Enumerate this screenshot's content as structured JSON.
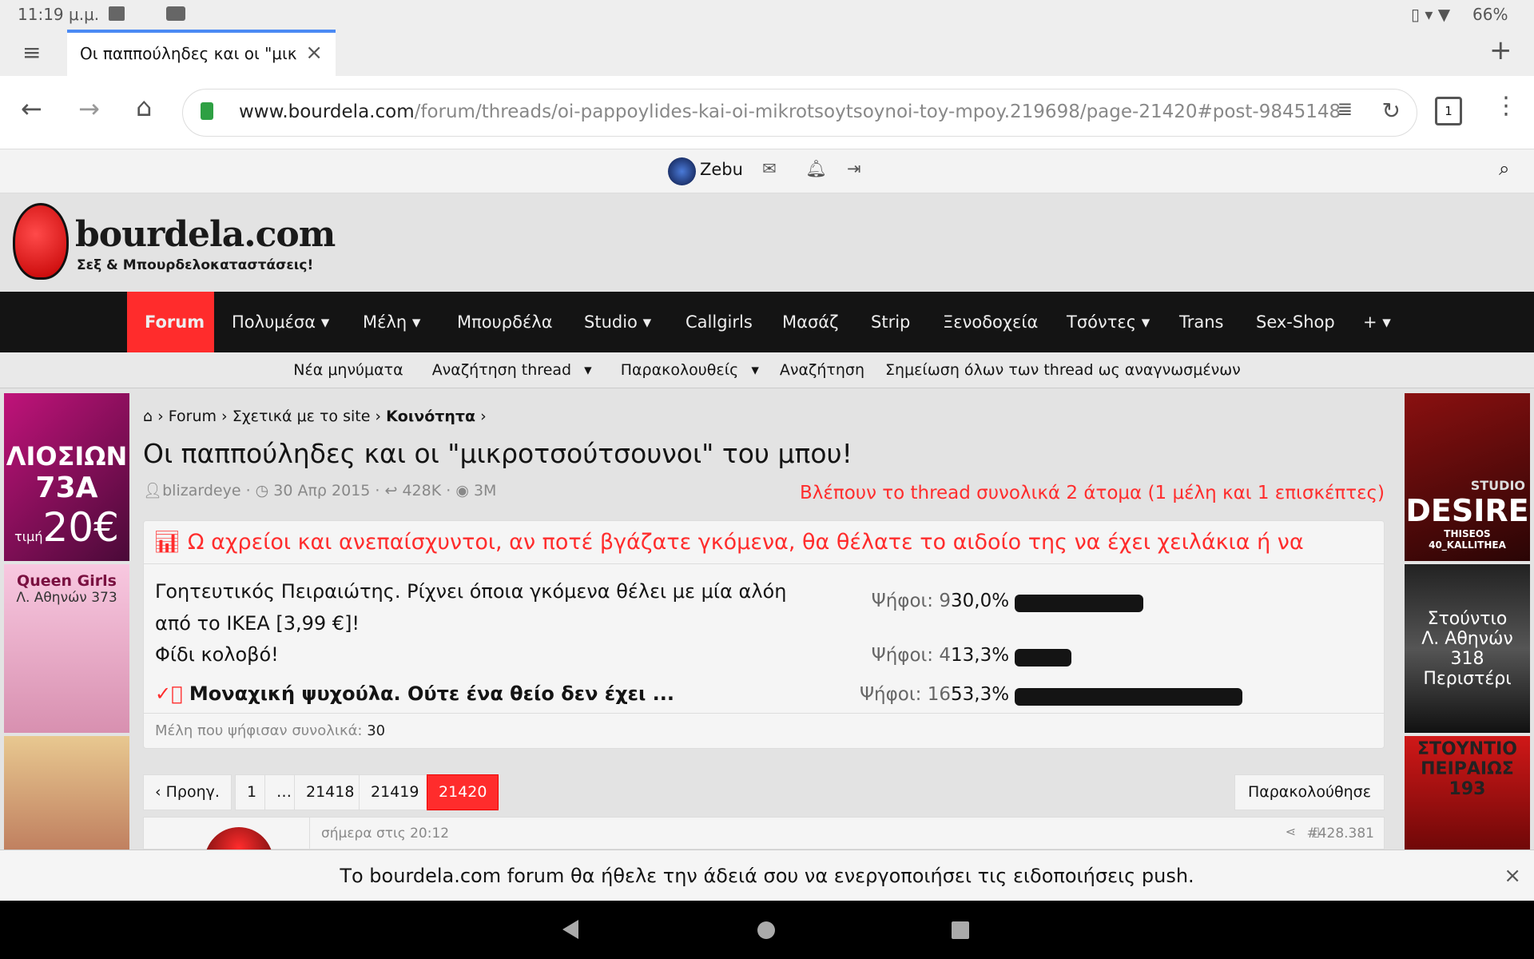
{
  "status": {
    "time": "11:19 μ.μ.",
    "battery": "66%"
  },
  "browser": {
    "tab_title": "Οι παππούληδες και οι \"μικ",
    "url_host": "www.bourdela.com",
    "url_path": "/forum/threads/oi-pappoylides-kai-oi-mikrotsoytsoynoi-toy-mpoy.219698/page-21420#post-9845148",
    "tab_count": "1"
  },
  "userbar": {
    "username": "Zebu"
  },
  "logo": {
    "name": "bourdela.com",
    "tagline": "Σεξ & Μπουρδελοκαταστάσεις!"
  },
  "nav": [
    "Forum",
    "Πολυμέσα",
    "Μέλη",
    "Μπουρδέλα",
    "Studio",
    "Callgirls",
    "Μασάζ",
    "Strip",
    "Ξενοδοχεία",
    "Τσόντες",
    "Trans",
    "Sex-Shop",
    "+"
  ],
  "subnav": [
    "Νέα μηνύματα",
    "Αναζήτηση thread",
    "Παρακολουθείς",
    "Αναζήτηση",
    "Σημείωση όλων των thread ως αναγνωσμένων"
  ],
  "breadcrumb": [
    "Forum",
    "Σχετικά με το site",
    "Κοινότητα"
  ],
  "thread": {
    "title": "Οι παππούληδες και οι \"μικροτσούτσουνοι\" του μπου!",
    "author": "blizardeye",
    "date": "30 Απρ 2015",
    "replies": "428K",
    "views": "3M",
    "viewers": "Βλέπουν το thread συνολικά 2 άτομα (1 μέλη και 1 επισκέπτες)"
  },
  "poll": {
    "question": "Ω αχρείοι και ανεπαίσχυντοι, αν ποτέ βγάζατε γκόμενα, θα θέλατε το αιδοίο της να έχει χειλάκια ή να",
    "options": [
      {
        "text": "Γοητευτικός Πειραιώτης. Ρίχνει όποια γκόμενα θέλει με μία αλόη από το ΙΚΕΑ [3,99 €]!",
        "votes": "Ψήφοι: 9",
        "pct": "30,0%",
        "value": 30.0
      },
      {
        "text": "Φίδι κολοβό!",
        "votes": "Ψήφοι: 4",
        "pct": "13,3%",
        "value": 13.3
      },
      {
        "text": "Μοναχική ψυχούλα. Ούτε ένα θείο δεν έχει ...",
        "votes": "Ψήφοι: 16",
        "pct": "53,3%",
        "value": 53.3,
        "selected": true
      }
    ],
    "total_label": "Μέλη που ψήφισαν συνολικά:",
    "total": "30"
  },
  "pagination": {
    "prev": "Προηγ.",
    "pages": [
      "1",
      "…",
      "21418",
      "21419",
      "21420"
    ],
    "current": "21420",
    "watch": "Παρακολούθησε"
  },
  "post": {
    "time": "σήμερα στις 20:12",
    "number": "#428.381"
  },
  "ads": {
    "left": [
      {
        "line1": "ΛΙΟΣΙΩΝ",
        "line2": "73Α",
        "price": "20€",
        "small": "τιμή"
      },
      {
        "line1": "Queen Girls",
        "line2": "Λ. Αθηνών 373"
      },
      {
        "line1": ""
      }
    ],
    "right": [
      {
        "line1": "STUDIO",
        "line2": "DESIRE",
        "line3": "THISEOS 40_KALLITHEA"
      },
      {
        "line1": "Στούντιο",
        "line2": "Λ. Αθηνών",
        "line3": "318",
        "line4": "Περιστέρι"
      },
      {
        "line1": "ΣΤΟΥΝΤΙΟ",
        "line2": "ΠΕΙΡΑΙΩΣ",
        "line3": "193"
      }
    ]
  },
  "push": {
    "message": "Το bourdela.com forum θα ήθελε την άδειά σου να ενεργοποιήσει τις ειδοποιήσεις push."
  },
  "colors": {
    "accent": "#ff2c2c",
    "nav_bg": "#141414"
  }
}
